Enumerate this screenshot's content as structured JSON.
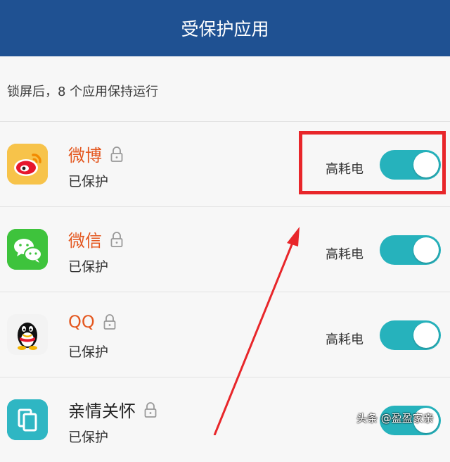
{
  "header": {
    "title": "受保护应用"
  },
  "subtitle": "锁屏后，8 个应用保持运行",
  "apps": [
    {
      "name": "微博",
      "status": "已保护",
      "tag": "高耗电",
      "enabled": true,
      "name_color": "#e4571f",
      "icon": "weibo-icon"
    },
    {
      "name": "微信",
      "status": "已保护",
      "tag": "高耗电",
      "enabled": true,
      "name_color": "#e4571f",
      "icon": "wechat-icon"
    },
    {
      "name": "QQ",
      "status": "已保护",
      "tag": "高耗电",
      "enabled": true,
      "name_color": "#e4571f",
      "icon": "qq-icon"
    },
    {
      "name": "亲情关怀",
      "status": "已保护",
      "tag": "",
      "enabled": true,
      "name_color": "#222222",
      "icon": "family-care-icon"
    }
  ],
  "watermark": "头条 @盈盈家亲",
  "colors": {
    "header": "#1f5192",
    "toggle_on": "#26b2bc",
    "annotation": "#e8262a"
  }
}
